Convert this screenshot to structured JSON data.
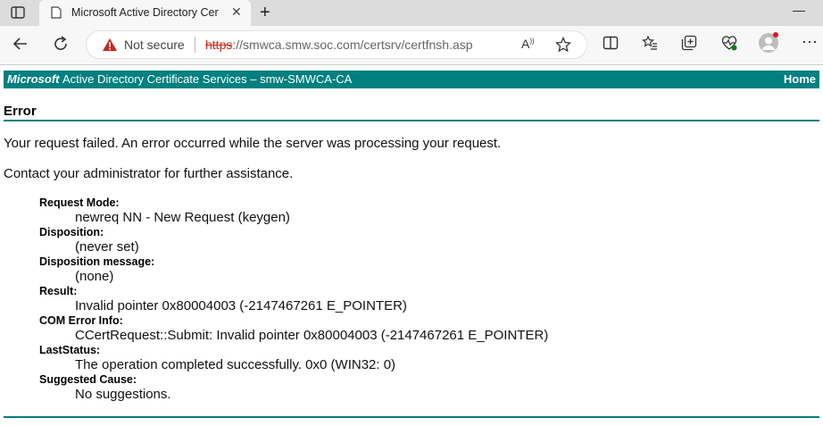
{
  "browser": {
    "tab_title": "Microsoft Active Directory Certifi",
    "not_secure": "Not secure",
    "url_scheme": "https",
    "url_rest": "://smwca.smw.soc.com/certsrv/certfnsh.asp",
    "icons": [
      "tab-actions-icon",
      "document-icon",
      "close-icon",
      "new-tab-icon",
      "minimize-icon",
      "back-icon",
      "refresh-icon",
      "warning-icon",
      "read-aloud-icon",
      "favorite-star-icon",
      "split-screen-icon",
      "favorites-icon",
      "collections-icon",
      "browser-essentials-icon",
      "profile-icon",
      "more-icon"
    ]
  },
  "banner": {
    "microsoft": "Microsoft",
    "title": "Active Directory Certificate Services  –  smw-SMWCA-CA",
    "home": "Home"
  },
  "error": {
    "heading": "Error",
    "line1": "Your request failed. An error occurred while the server was processing your request.",
    "line2": "Contact your administrator for further assistance."
  },
  "details": [
    {
      "label": "Request Mode:",
      "value": "newreq NN - New Request (keygen)"
    },
    {
      "label": "Disposition:",
      "value": "(never set)"
    },
    {
      "label": "Disposition message:",
      "value": "(none)"
    },
    {
      "label": "Result:",
      "value": "Invalid pointer 0x80004003 (-2147467261 E_POINTER)"
    },
    {
      "label": "COM Error Info:",
      "value": "CCertRequest::Submit: Invalid pointer 0x80004003 (-2147467261 E_POINTER)"
    },
    {
      "label": "LastStatus:",
      "value": "The operation completed successfully. 0x0 (WIN32: 0)"
    },
    {
      "label": "Suggested Cause:",
      "value": "No suggestions."
    }
  ],
  "colors": {
    "accent": "#008080",
    "insecure": "#c42b1c"
  }
}
